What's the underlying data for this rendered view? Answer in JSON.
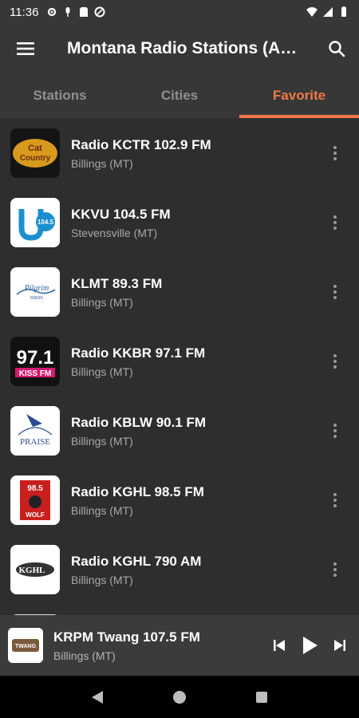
{
  "status": {
    "time": "11:36"
  },
  "appbar": {
    "title": "Montana Radio Stations (A…"
  },
  "tabs": [
    {
      "label": "Stations",
      "active": false
    },
    {
      "label": "Cities",
      "active": false
    },
    {
      "label": "Favorite",
      "active": true
    }
  ],
  "stations": [
    {
      "name": "Radio KCTR 102.9 FM",
      "city": "Billings (MT)",
      "logo_text": "Cat Country 102.9"
    },
    {
      "name": "KKVU 104.5 FM",
      "city": "Stevensville (MT)",
      "logo_text": "104.5"
    },
    {
      "name": "KLMT 89.3 FM",
      "city": "Billings (MT)",
      "logo_text": "Pilgrim Radio"
    },
    {
      "name": "Radio KKBR 97.1 FM",
      "city": "Billings (MT)",
      "logo_text": "97.1 KISS FM"
    },
    {
      "name": "Radio KBLW 90.1 FM",
      "city": "Billings (MT)",
      "logo_text": "PRAISE"
    },
    {
      "name": "Radio KGHL 98.5 FM",
      "city": "Billings (MT)",
      "logo_text": "98.5 THE WOLF"
    },
    {
      "name": "Radio KGHL 790 AM",
      "city": "Billings (MT)",
      "logo_text": "KGHL"
    }
  ],
  "player": {
    "name": "KRPM Twang 107.5 FM",
    "city": "Billings (MT)",
    "logo_text": "TWANG"
  },
  "colors": {
    "accent": "#ef7a45",
    "bar": "#373737",
    "list_bg": "#2e2e2e"
  }
}
